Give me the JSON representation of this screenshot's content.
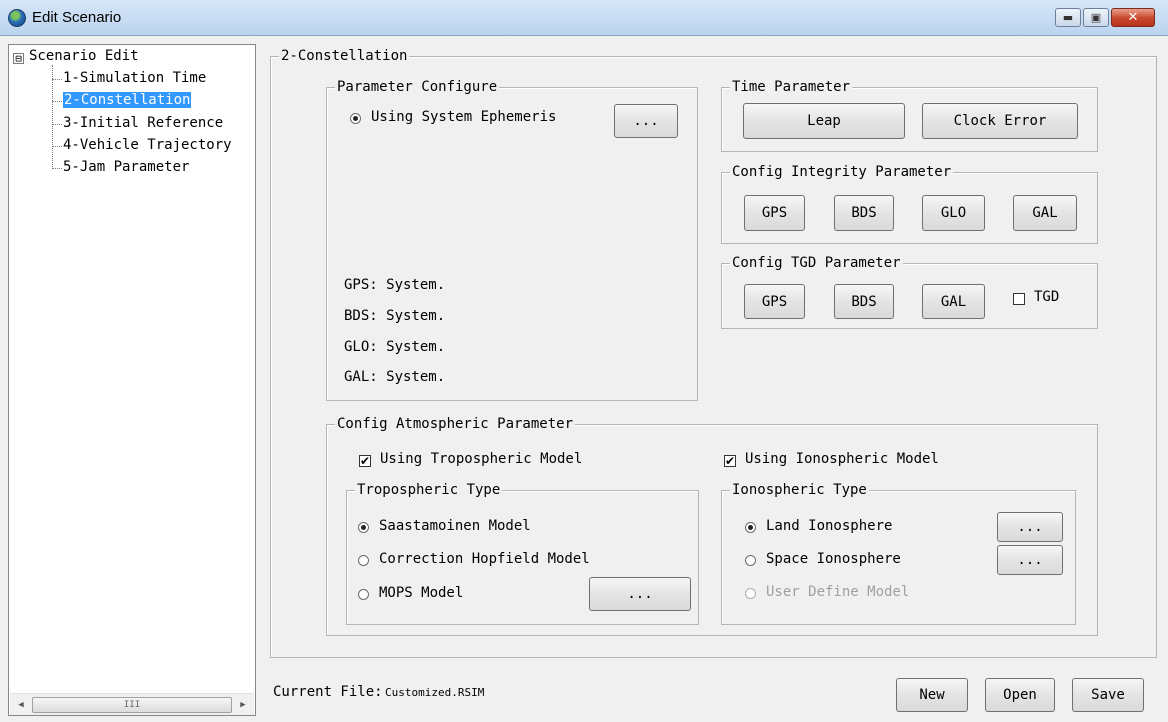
{
  "window": {
    "title": "Edit Scenario",
    "minimize_glyph": "▬",
    "maximize_glyph": "▣",
    "close_glyph": "✕"
  },
  "tree": {
    "expander": "⊟",
    "root": "Scenario Edit",
    "items": [
      {
        "label": "1-Simulation Time",
        "selected": false
      },
      {
        "label": "2-Constellation",
        "selected": true
      },
      {
        "label": "3-Initial Reference",
        "selected": false
      },
      {
        "label": "4-Vehicle Trajectory",
        "selected": false
      },
      {
        "label": "5-Jam Parameter",
        "selected": false
      }
    ],
    "scroll_left_glyph": "◀",
    "scroll_right_glyph": "▶",
    "scroll_thumb_glyph": "III"
  },
  "main": {
    "section_title": "2-Constellation",
    "parameter_configure": {
      "title": "Parameter Configure",
      "using_system_ephemeris": "Using System Ephemeris",
      "ellipsis": "...",
      "status_lines": [
        "GPS: System.",
        "BDS: System.",
        "GLO: System.",
        "GAL: System."
      ]
    },
    "time_parameter": {
      "title": "Time Parameter",
      "leap": "Leap",
      "clock_error": "Clock Error"
    },
    "integrity": {
      "title": "Config Integrity Parameter",
      "buttons": [
        "GPS",
        "BDS",
        "GLO",
        "GAL"
      ]
    },
    "tgd": {
      "title": "Config TGD Parameter",
      "buttons": [
        "GPS",
        "BDS",
        "GAL"
      ],
      "checkbox_label": "TGD",
      "checkbox_checked": false
    },
    "atmospheric": {
      "title": "Config Atmospheric Parameter",
      "use_tropo": "Using Tropospheric Model",
      "use_iono": "Using Ionospheric  Model",
      "tropo_type": {
        "title": "Tropospheric Type",
        "options": [
          "Saastamoinen Model",
          "Correction Hopfield Model",
          "MOPS Model"
        ],
        "selected": "Saastamoinen Model",
        "ellipsis": "..."
      },
      "iono_type": {
        "title": "Ionospheric Type",
        "options": [
          "Land Ionosphere",
          "Space Ionosphere",
          "User Define Model"
        ],
        "selected": "Land Ionosphere",
        "disabled": "User Define Model",
        "ellipsis": "..."
      }
    },
    "footer": {
      "current_file_label": "Current File:",
      "current_file_value": "Customized.RSIM",
      "new": "New",
      "open": "Open",
      "save": "Save"
    }
  }
}
